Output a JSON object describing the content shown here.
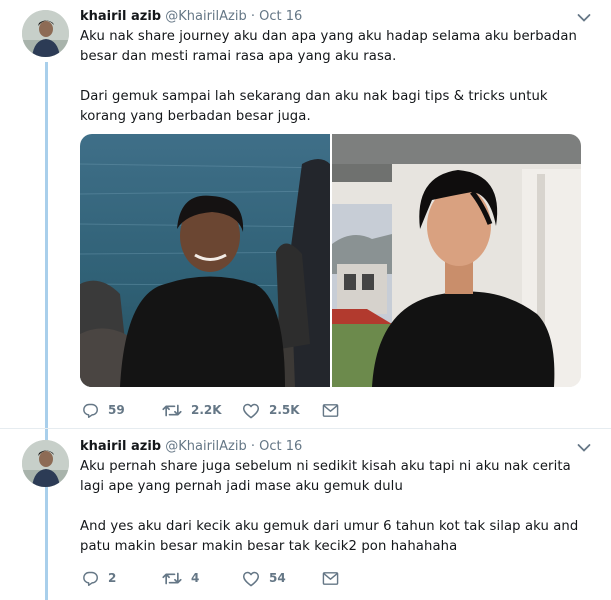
{
  "tweets": [
    {
      "author": {
        "name": "khairil azib",
        "handle": "@KhairilAzib",
        "separator": "·",
        "time": "Oct 16"
      },
      "paragraphs": [
        "Aku nak share journey aku dan apa yang aku hadap selama aku berbadan besar dan mesti ramai rasa apa yang aku rasa.",
        "Dari gemuk sampai lah sekarang dan aku nak bagi tips & tricks untuk korang yang berbadan besar juga."
      ],
      "stats": {
        "replies": "59",
        "retweets": "2.2K",
        "likes": "2.5K"
      }
    },
    {
      "author": {
        "name": "khairil azib",
        "handle": "@KhairilAzib",
        "separator": "·",
        "time": "Oct 16"
      },
      "paragraphs": [
        "Aku pernah share juga sebelum ni sedikit kisah aku tapi ni aku nak cerita lagi ape yang pernah jadi mase aku gemuk dulu",
        "And yes aku dari kecik aku gemuk dari umur 6 tahun kot tak silap aku and patu makin besar makin besar tak kecik2 pon hahahaha"
      ],
      "stats": {
        "replies": "2",
        "retweets": "4",
        "likes": "54"
      }
    }
  ],
  "icons": {
    "reply": "reply-icon",
    "retweet": "retweet-icon",
    "like": "heart-icon",
    "dm": "mail-icon",
    "caret": "chevron-down-icon"
  },
  "colors": {
    "thread_line": "#a9cfeb",
    "muted": "#657786",
    "text": "#14171a"
  }
}
